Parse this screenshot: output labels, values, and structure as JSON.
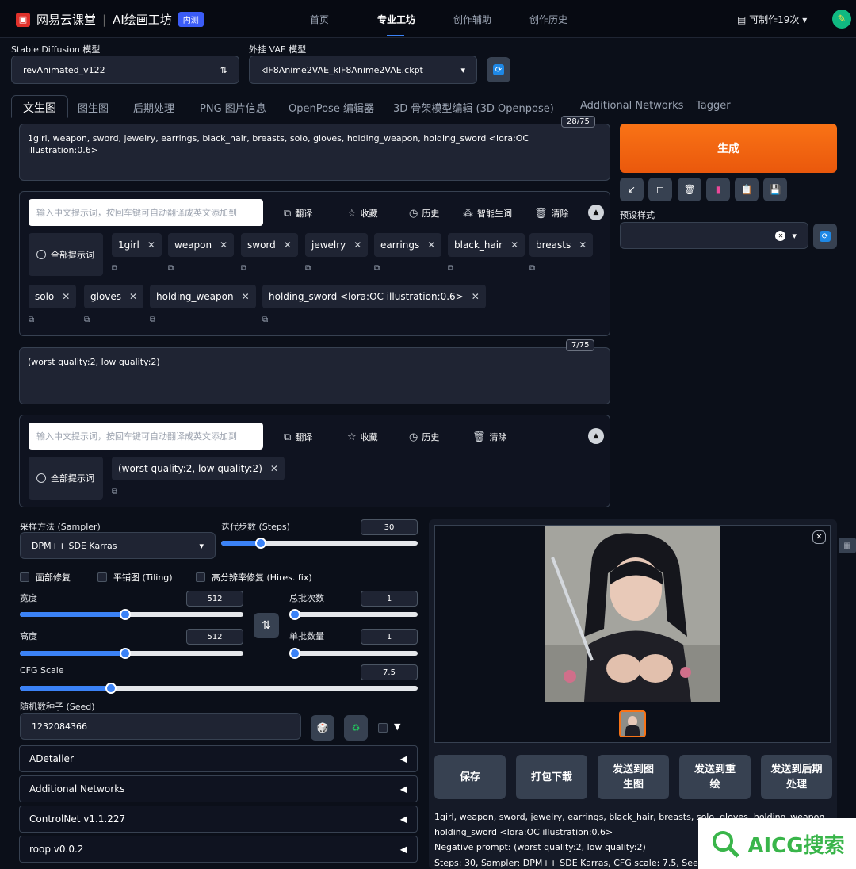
{
  "header": {
    "brand": "网易云课堂",
    "app": "AI绘画工坊",
    "badge": "内测",
    "nav": [
      "首页",
      "专业工坊",
      "创作辅助",
      "创作历史"
    ],
    "credits": "可制作19次"
  },
  "models": {
    "sd_label": "Stable Diffusion 模型",
    "sd_value": "revAnimated_v122",
    "vae_label": "外挂 VAE 模型",
    "vae_value": "klF8Anime2VAE_klF8Anime2VAE.ckpt"
  },
  "tabs": [
    "文生图",
    "图生图",
    "后期处理",
    "PNG 图片信息",
    "OpenPose 编辑器",
    "3D 骨架模型编辑 (3D Openpose)",
    "Additional Networks",
    "Tagger"
  ],
  "prompt": {
    "text": "1girl, weapon, sword, jewelry, earrings, black_hair, breasts, solo, gloves, holding_weapon, holding_sword <lora:OC illustration:0.6>",
    "counter": "28/75",
    "input_placeholder": "输入中文提示词，按回车键可自动翻译成英文添加到",
    "tools": [
      "翻译",
      "收藏",
      "历史",
      "智能生词",
      "清除"
    ],
    "all_label": "全部提示词",
    "tags": [
      "1girl",
      "weapon",
      "sword",
      "jewelry",
      "earrings",
      "black_hair",
      "breasts",
      "solo",
      "gloves",
      "holding_weapon",
      "holding_sword <lora:OC illustration:0.6>"
    ]
  },
  "negative": {
    "text": "(worst quality:2, low quality:2)",
    "counter": "7/75",
    "input_placeholder": "输入中文提示词，按回车键可自动翻译成英文添加到",
    "tools": [
      "翻译",
      "收藏",
      "历史",
      "清除"
    ],
    "all_label": "全部提示词",
    "tags": [
      "(worst quality:2, low quality:2)"
    ]
  },
  "generate": {
    "label": "生成",
    "preset_label": "预设样式"
  },
  "params": {
    "sampler_label": "采样方法 (Sampler)",
    "sampler_value": "DPM++ SDE Karras",
    "steps_label": "迭代步数 (Steps)",
    "steps": 30,
    "face_fix": "面部修复",
    "tiling": "平铺图 (Tiling)",
    "hires": "高分辨率修复 (Hires. fix)",
    "width_label": "宽度",
    "width": 512,
    "height_label": "高度",
    "height": 512,
    "batch_count_label": "总批次数",
    "batch_count": 1,
    "batch_size_label": "单批数量",
    "batch_size": 1,
    "cfg_label": "CFG Scale",
    "cfg": 7.5,
    "seed_label": "随机数种子 (Seed)",
    "seed": "1232084366"
  },
  "sliders": {
    "steps_frac": 0.2,
    "width_frac": 0.47,
    "height_frac": 0.47,
    "cfg_frac": 0.23,
    "batch_count_frac": 0.0,
    "batch_size_frac": 0.0
  },
  "accordions": [
    "ADetailer",
    "Additional Networks",
    "ControlNet v1.1.227",
    "roop v0.0.2"
  ],
  "output": {
    "actions": [
      "保存",
      "打包下载",
      "发送到图生图",
      "发送到重绘",
      "发送到后期处理"
    ],
    "info1": "1girl, weapon, sword, jewelry, earrings, black_hair, breasts, solo, gloves, holding_weapon,",
    "info2": "holding_sword <lora:OC illustration:0.6>",
    "info3": "Negative prompt: (worst quality:2, low quality:2)",
    "info4": "Steps: 30, Sampler: DPM++ SDE Karras, CFG scale: 7.5, Seed: 123208"
  },
  "watermark": "AICG搜索",
  "colors": {
    "accent": "#3b82f6",
    "generate": "#f97316",
    "background": "#0b0f19"
  }
}
